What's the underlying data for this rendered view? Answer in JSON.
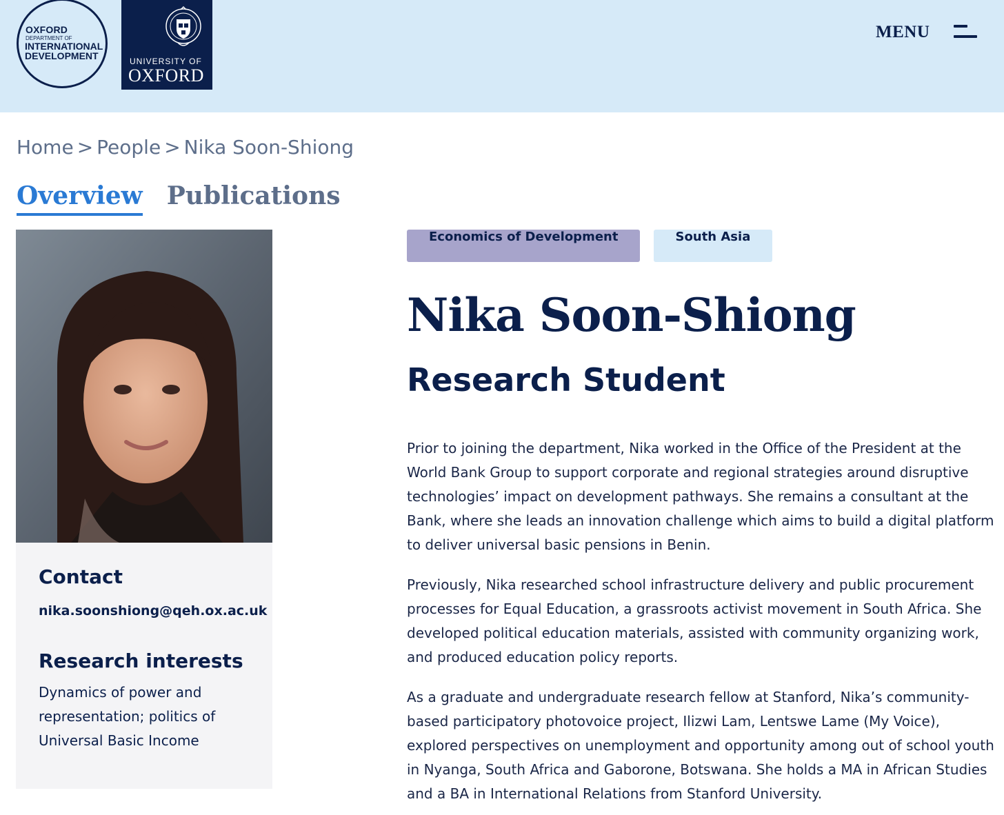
{
  "header": {
    "odid_logo": {
      "line1": "OXFORD",
      "line2": "DEPARTMENT OF",
      "line3": "INTERNATIONAL",
      "line4": "DEVELOPMENT"
    },
    "oxford_logo": {
      "line1": "UNIVERSITY OF",
      "line2": "OXFORD"
    },
    "menu_label": "MENU",
    "menu_icon": "hamburger-icon"
  },
  "breadcrumb": {
    "items": [
      "Home",
      "People",
      "Nika Soon-Shiong"
    ],
    "separator": ">"
  },
  "tabs": [
    {
      "label": "Overview",
      "active": true
    },
    {
      "label": "Publications",
      "active": false
    }
  ],
  "profile": {
    "contact_heading": "Contact",
    "email": "nika.soonshiong@qeh.ox.ac.uk",
    "interests_heading": "Research interests",
    "interests": "Dynamics of power and representation; politics of Universal Basic Income"
  },
  "tags": [
    "Economics of Development",
    "South Asia"
  ],
  "name": "Nika Soon-Shiong",
  "role": "Research Student",
  "bio": [
    "Prior to joining the department, Nika worked in the Office of the President at the World Bank Group to support corporate and regional strategies around disruptive technologies’ impact on development pathways. She remains a consultant at the Bank, where she leads an innovation challenge which aims to build a digital platform to deliver universal basic pensions in Benin.",
    "Previously, Nika researched school infrastructure delivery and public procurement processes for Equal Education, a grassroots activist movement in South Africa. She developed political education materials, assisted with community organizing work, and produced education policy reports.",
    "As a graduate and undergraduate research fellow at Stanford, Nika’s community-based participatory photovoice project, Ilizwi Lam, Lentswe Lame (My Voice), explored perspectives on unemployment and opportunity among out of school youth in Nyanga, South Africa and Gaborone, Botswana. She holds a MA in African Studies and a BA in International Relations from Stanford University."
  ],
  "colors": {
    "navy": "#0b1f4b",
    "header_bg": "#d6eaf8",
    "active_tab": "#2a7ad4",
    "muted": "#5d6e8a",
    "tag_purple": "#a7a4cb",
    "panel_bg": "#f4f4f6"
  }
}
